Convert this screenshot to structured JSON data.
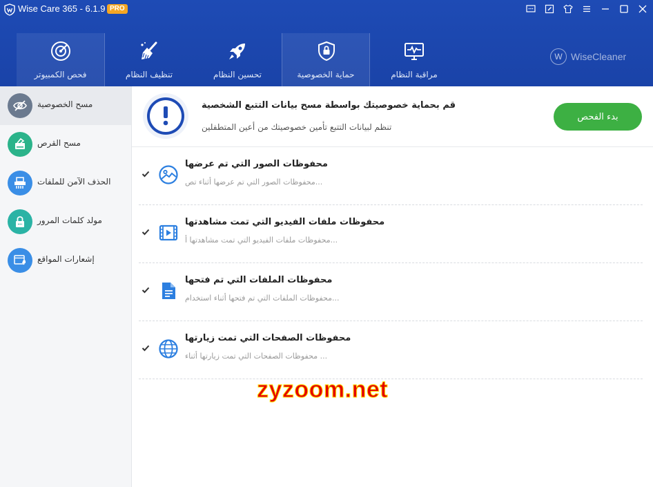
{
  "app": {
    "title": "Wise Care 365 - 6.1.9",
    "badge": "PRO",
    "brand": "WiseCleaner",
    "brand_logo_letter": "W",
    "header_color": "#1e4bb5",
    "accent_green": "#3db043"
  },
  "window_controls": [
    {
      "name": "feedback-icon"
    },
    {
      "name": "edit-icon"
    },
    {
      "name": "skin-icon"
    },
    {
      "name": "menu-icon"
    },
    {
      "name": "minimize-icon"
    },
    {
      "name": "maximize-icon"
    },
    {
      "name": "close-icon"
    }
  ],
  "nav": [
    {
      "label": "فحص الكمبيوتر",
      "icon": "radar-icon",
      "active": true
    },
    {
      "label": "تنظيف النظام",
      "icon": "broom-icon",
      "active": false
    },
    {
      "label": "تحسين النظام",
      "icon": "rocket-icon",
      "active": false
    },
    {
      "label": "حماية الخصوصية",
      "icon": "shield-lock-icon",
      "active": false
    },
    {
      "label": "مراقبة النظام",
      "icon": "monitor-pulse-icon",
      "active": false
    }
  ],
  "sidebar": [
    {
      "label": "مسح الخصوصية",
      "icon": "eye-off-icon",
      "color": "#6b7a8f",
      "active": true
    },
    {
      "label": "مسح القرص",
      "icon": "disk-eraser-icon",
      "color": "#2bb38a",
      "active": false
    },
    {
      "label": "الحذف الآمن للملفات",
      "icon": "shredder-icon",
      "color": "#3a8ee6",
      "active": false
    },
    {
      "label": "مولد كلمات المرور",
      "icon": "lock-icon",
      "color": "#2bb3a5",
      "active": false
    },
    {
      "label": "إشعارات المواقع",
      "icon": "browser-bell-icon",
      "color": "#3a8ee6",
      "active": false
    }
  ],
  "banner": {
    "title": "قم بحماية خصوصيتك بواسطة مسح بيانات التتبع الشخصية",
    "subtitle": "تنظم لبيانات التتبع تأمين خصوصيتك من أعين المتطفلين",
    "start_button": "بدء الفحص"
  },
  "items": [
    {
      "title": "محفوظات الصور التي تم عرضها",
      "desc": "محفوظات الصور التي تم عرضها أثناء تص...",
      "icon": "image-icon",
      "checked": true
    },
    {
      "title": "محفوظات ملفات الفيديو التي تمت مشاهدتها",
      "desc": "محفوظات ملفات الفيديو التي تمت مشاهدتها أ...",
      "icon": "video-icon",
      "checked": true
    },
    {
      "title": "محفوظات الملفات التي تم فتحها",
      "desc": "محفوظات الملفات التي تم فتحها أثناء استخدام...",
      "icon": "document-icon",
      "checked": true
    },
    {
      "title": "محفوظات الصفحات التي تمت زيارتها",
      "desc": "محفوظات الصفحات التي تمت زيارتها أثناء ...",
      "icon": "globe-icon",
      "checked": true
    }
  ],
  "watermark": "zyzoom.net"
}
